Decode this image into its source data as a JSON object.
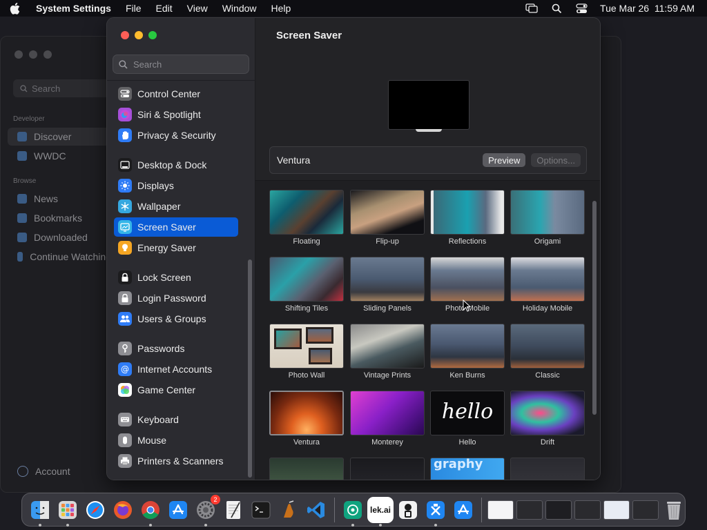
{
  "menubar": {
    "apple_icon": "apple-logo",
    "app_name": "System Settings",
    "menus": [
      "File",
      "Edit",
      "View",
      "Window",
      "Help"
    ],
    "status_icons": [
      "screen-mirroring-icon",
      "search-icon",
      "control-center-icon"
    ],
    "datetime": "Tue Mar 26  11:59 AM"
  },
  "background_window": {
    "search_placeholder": "Search",
    "section_developer": "Developer",
    "section_browse": "Browse",
    "items": [
      "Discover",
      "WWDC",
      "News",
      "Bookmarks",
      "Downloaded",
      "Continue Watching"
    ],
    "account": "Account"
  },
  "sidebar": {
    "search_placeholder": "Search",
    "items": [
      {
        "label": "Control Center",
        "icon": "control-center-icon",
        "color": "#636366"
      },
      {
        "label": "Siri & Spotlight",
        "icon": "siri-icon",
        "color": "#a74fd9"
      },
      {
        "label": "Privacy & Security",
        "icon": "hand-icon",
        "color": "#2f7cf6"
      },
      {
        "label": "Desktop & Dock",
        "icon": "dock-icon",
        "color": "#1c1c1e"
      },
      {
        "label": "Displays",
        "icon": "sun-icon",
        "color": "#2f7cf6"
      },
      {
        "label": "Wallpaper",
        "icon": "snowflake-icon",
        "color": "#36a8e0"
      },
      {
        "label": "Screen Saver",
        "icon": "screen-saver-icon",
        "color": "#35b6e8"
      },
      {
        "label": "Energy Saver",
        "icon": "bulb-icon",
        "color": "#f5a623"
      },
      {
        "label": "Lock Screen",
        "icon": "lock-icon",
        "color": "#1c1c1e"
      },
      {
        "label": "Login Password",
        "icon": "lock-icon",
        "color": "#8e8e93"
      },
      {
        "label": "Users & Groups",
        "icon": "users-icon",
        "color": "#2f7cf6"
      },
      {
        "label": "Passwords",
        "icon": "key-icon",
        "color": "#8e8e93"
      },
      {
        "label": "Internet Accounts",
        "icon": "at-icon",
        "color": "#2f7cf6"
      },
      {
        "label": "Game Center",
        "icon": "game-center-icon",
        "color": "#ffffff"
      },
      {
        "label": "Keyboard",
        "icon": "keyboard-icon",
        "color": "#8e8e93"
      },
      {
        "label": "Mouse",
        "icon": "mouse-icon",
        "color": "#8e8e93"
      },
      {
        "label": "Printers & Scanners",
        "icon": "printer-icon",
        "color": "#8e8e93"
      }
    ],
    "selected": "Screen Saver"
  },
  "content": {
    "title": "Screen Saver",
    "current_saver": "Ventura",
    "preview_label": "Preview",
    "options_label": "Options..."
  },
  "savers": [
    {
      "label": "Floating"
    },
    {
      "label": "Flip-up"
    },
    {
      "label": "Reflections"
    },
    {
      "label": "Origami"
    },
    {
      "label": "Shifting Tiles"
    },
    {
      "label": "Sliding Panels"
    },
    {
      "label": "Photo Mobile"
    },
    {
      "label": "Holiday Mobile"
    },
    {
      "label": "Photo Wall"
    },
    {
      "label": "Vintage Prints"
    },
    {
      "label": "Ken Burns"
    },
    {
      "label": "Classic"
    },
    {
      "label": "Ventura"
    },
    {
      "label": "Monterey"
    },
    {
      "label": "Hello",
      "thumb_text": "hello"
    },
    {
      "label": "Drift"
    },
    {
      "label": ""
    },
    {
      "label": ""
    },
    {
      "label": "",
      "thumb_text": "graphy"
    },
    {
      "label": ""
    }
  ],
  "dock": {
    "apps": [
      {
        "name": "finder-icon",
        "color": "#3a9af0"
      },
      {
        "name": "launchpad-icon",
        "color": "#e8e8e8"
      },
      {
        "name": "safari-icon",
        "color": "#1e8ff0"
      },
      {
        "name": "firefox-icon",
        "color": "#e85a2a"
      },
      {
        "name": "chrome-icon",
        "color": "#ffffff"
      },
      {
        "name": "app-store-icon",
        "color": "#1f86f2"
      },
      {
        "name": "system-settings-icon",
        "color": "#8a8a8e",
        "badge": "2"
      },
      {
        "name": "textedit-icon",
        "color": "#f2f2f2"
      },
      {
        "name": "terminal-icon",
        "color": "#1a1a1a"
      },
      {
        "name": "instruments-icon",
        "color": "#5a3a20"
      },
      {
        "name": "vscode-icon",
        "color": "#1f1f22"
      },
      {
        "name": "chatgpt-icon",
        "color": "#10a37f"
      },
      {
        "name": "lekai-icon",
        "color": "#ffffff",
        "text": "lek.ai"
      },
      {
        "name": "profile-icon",
        "color": "#f2f2f2"
      },
      {
        "name": "xcode-icon",
        "color": "#1f86f2"
      },
      {
        "name": "simulator-icon",
        "color": "#1f86f2"
      }
    ],
    "trash_icon": "trash-icon"
  }
}
